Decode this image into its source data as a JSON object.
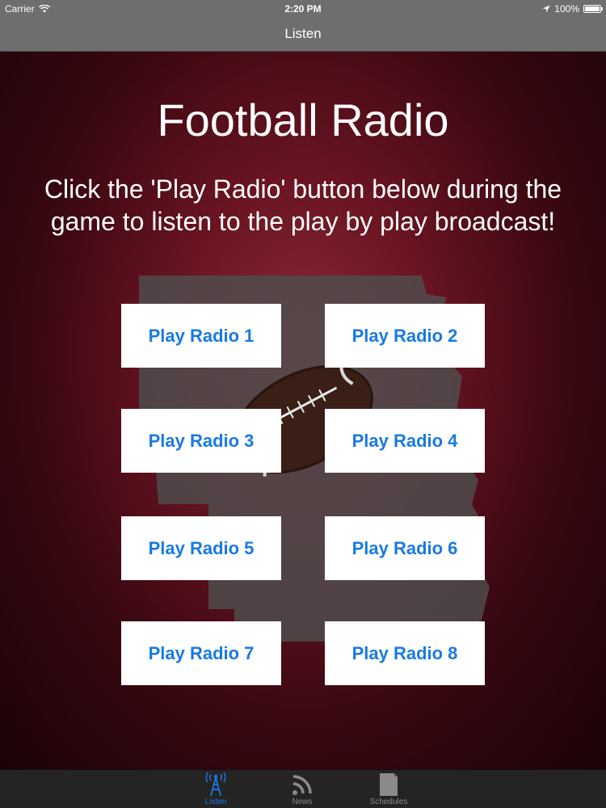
{
  "status_bar": {
    "carrier": "Carrier",
    "time": "2:20 PM",
    "battery": "100%"
  },
  "nav": {
    "title": "Listen"
  },
  "main": {
    "title": "Football Radio",
    "instructions": "Click the 'Play Radio' button below during the game to listen to the play by play broadcast!",
    "buttons": [
      {
        "label": "Play Radio 1"
      },
      {
        "label": "Play Radio 2"
      },
      {
        "label": "Play Radio 3"
      },
      {
        "label": "Play Radio 4"
      },
      {
        "label": "Play Radio 5"
      },
      {
        "label": "Play Radio 6"
      },
      {
        "label": "Play Radio 7"
      },
      {
        "label": "Play Radio 8"
      }
    ]
  },
  "tabs": [
    {
      "label": "Listen",
      "icon": "radio-tower-icon",
      "active": true
    },
    {
      "label": "News",
      "icon": "rss-icon",
      "active": false
    },
    {
      "label": "Schedules",
      "icon": "schedule-icon",
      "active": false
    }
  ],
  "colors": {
    "accent": "#1a7ae0",
    "bar_gray": "#6e6e6e",
    "background": "#5a0f1c"
  }
}
